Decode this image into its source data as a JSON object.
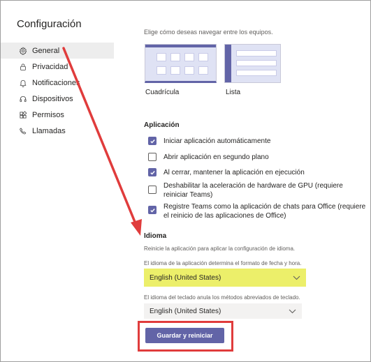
{
  "title": "Configuración",
  "sidebar": {
    "items": [
      {
        "label": "General",
        "icon": "gear-icon",
        "active": true
      },
      {
        "label": "Privacidad",
        "icon": "lock-icon"
      },
      {
        "label": "Notificaciones",
        "icon": "bell-icon"
      },
      {
        "label": "Dispositivos",
        "icon": "headset-icon"
      },
      {
        "label": "Permisos",
        "icon": "apps-icon"
      },
      {
        "label": "Llamadas",
        "icon": "phone-icon"
      }
    ]
  },
  "layout": {
    "hint": "Elige cómo deseas navegar entre los equipos.",
    "grid_label": "Cuadrícula",
    "list_label": "Lista"
  },
  "application": {
    "title": "Aplicación",
    "options": [
      {
        "label": "Iniciar aplicación automáticamente",
        "checked": true
      },
      {
        "label": "Abrir aplicación en segundo plano",
        "checked": false
      },
      {
        "label": "Al cerrar, mantener la aplicación en ejecución",
        "checked": true
      },
      {
        "label": "Deshabilitar la aceleración de hardware de GPU (requiere reiniciar Teams)",
        "checked": false
      },
      {
        "label": "Registre Teams como la aplicación de chats para Office (requiere el reinicio de las aplicaciones de Office)",
        "checked": true
      }
    ]
  },
  "language": {
    "title": "Idioma",
    "restart_hint": "Reinicie la aplicación para aplicar la configuración de idioma.",
    "app_lang_hint": "El idioma de la aplicación determina el formato de fecha y hora.",
    "app_lang_value": "English (United States)",
    "keyboard_hint": "El idioma del teclado anula los métodos abreviados de teclado.",
    "keyboard_value": "English (United States)",
    "save_label": "Guardar y reiniciar"
  },
  "colors": {
    "accent": "#6264a7",
    "annotation": "#e03c3c",
    "highlight": "#ecef6a"
  }
}
